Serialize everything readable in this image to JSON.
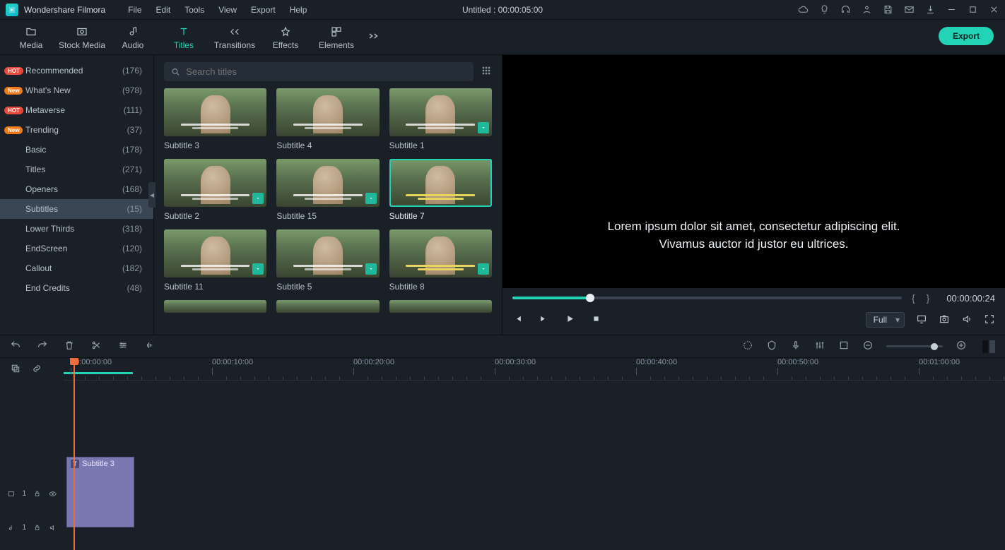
{
  "app_name": "Wondershare Filmora",
  "menubar": [
    "File",
    "Edit",
    "Tools",
    "View",
    "Export",
    "Help"
  ],
  "project_title": "Untitled : 00:00:05:00",
  "ribbon": {
    "tabs": [
      {
        "label": "Media"
      },
      {
        "label": "Stock Media"
      },
      {
        "label": "Audio"
      },
      {
        "label": "Titles"
      },
      {
        "label": "Transitions"
      },
      {
        "label": "Effects"
      },
      {
        "label": "Elements"
      }
    ],
    "active": 3,
    "export": "Export"
  },
  "sidebar": [
    {
      "label": "Recommended",
      "count": "(176)",
      "badge": "HOT"
    },
    {
      "label": "What's New",
      "count": "(978)",
      "badge": "New"
    },
    {
      "label": "Metaverse",
      "count": "(111)",
      "badge": "HOT"
    },
    {
      "label": "Trending",
      "count": "(37)",
      "badge": "New"
    },
    {
      "label": "Basic",
      "count": "(178)"
    },
    {
      "label": "Titles",
      "count": "(271)"
    },
    {
      "label": "Openers",
      "count": "(168)"
    },
    {
      "label": "Subtitles",
      "count": "(15)",
      "active": true
    },
    {
      "label": "Lower Thirds",
      "count": "(318)"
    },
    {
      "label": "EndScreen",
      "count": "(120)"
    },
    {
      "label": "Callout",
      "count": "(182)"
    },
    {
      "label": "End Credits",
      "count": "(48)"
    }
  ],
  "search": {
    "placeholder": "Search titles"
  },
  "grid": [
    {
      "label": "Subtitle 3",
      "style": "white"
    },
    {
      "label": "Subtitle 4",
      "style": "white"
    },
    {
      "label": "Subtitle 1",
      "style": "white",
      "dl": true
    },
    {
      "label": "Subtitle 2",
      "style": "white",
      "dl": true
    },
    {
      "label": "Subtitle 15",
      "style": "white",
      "dl": true
    },
    {
      "label": "Subtitle 7",
      "style": "yellow",
      "selected": true
    },
    {
      "label": "Subtitle 11",
      "style": "white",
      "dl": true
    },
    {
      "label": "Subtitle 5",
      "style": "white",
      "dl": true
    },
    {
      "label": "Subtitle 8",
      "style": "yellow",
      "dl": true
    }
  ],
  "preview": {
    "text_line1": "Lorem ipsum dolor sit amet, consectetur adipiscing elit.",
    "text_line2": "Vivamus auctor id justor eu ultrices.",
    "markers_l": "{",
    "markers_r": "}",
    "timecode": "00:00:00:24",
    "quality": "Full"
  },
  "timeline": {
    "ruler": [
      "00:00:00:00",
      "00:00:10:00",
      "00:00:20:00",
      "00:00:30:00",
      "00:00:40:00",
      "00:00:50:00",
      "00:01:00:00"
    ],
    "clip_label": "Subtitle 3",
    "video_track": "1",
    "audio_track": "1"
  }
}
